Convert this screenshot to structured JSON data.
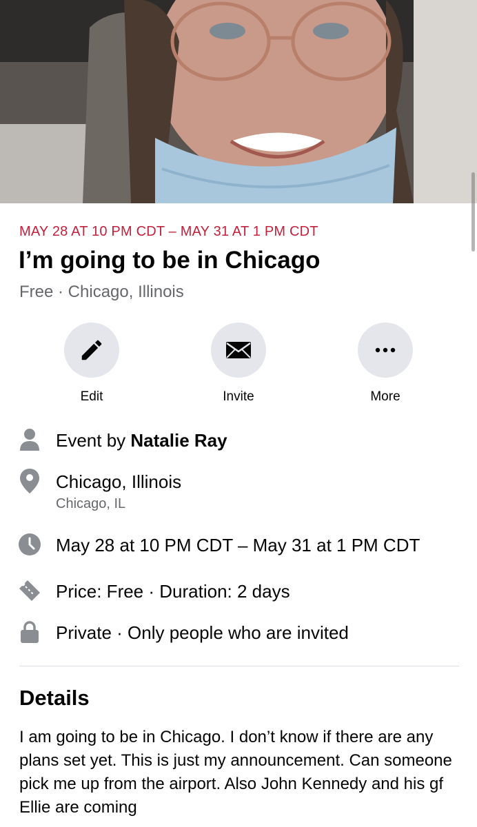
{
  "cover": {
    "alt_icon": "cover-photo"
  },
  "event": {
    "date_range": "MAY 28 AT 10 PM CDT – MAY 31 AT 1 PM CDT",
    "title": "I’m going to be in Chicago",
    "price_location": "Free · Chicago, Illinois"
  },
  "actions": [
    {
      "label": "Edit",
      "icon": "pencil-icon"
    },
    {
      "label": "Invite",
      "icon": "envelope-icon"
    },
    {
      "label": "More",
      "icon": "more-dots-icon"
    }
  ],
  "info": {
    "host_prefix": "Event by ",
    "host_name": "Natalie Ray",
    "location_name": "Chicago, Illinois",
    "location_sub": "Chicago, IL",
    "datetime": "May 28 at 10 PM CDT – May 31 at 1 PM CDT",
    "price_duration": "Price: Free · Duration: 2 days",
    "privacy": "Private · Only people who are invited"
  },
  "details": {
    "heading": "Details",
    "body": "I am going to be in Chicago. I don’t know if there are any plans set yet. This is just my announcement. Can someone pick me up from the airport. Also John Kennedy and his gf Ellie are coming"
  },
  "colors": {
    "date_accent": "#c2213c",
    "secondary_text": "#65676b",
    "icon_gray": "#8a8d91",
    "button_bg": "#e4e6eb"
  }
}
